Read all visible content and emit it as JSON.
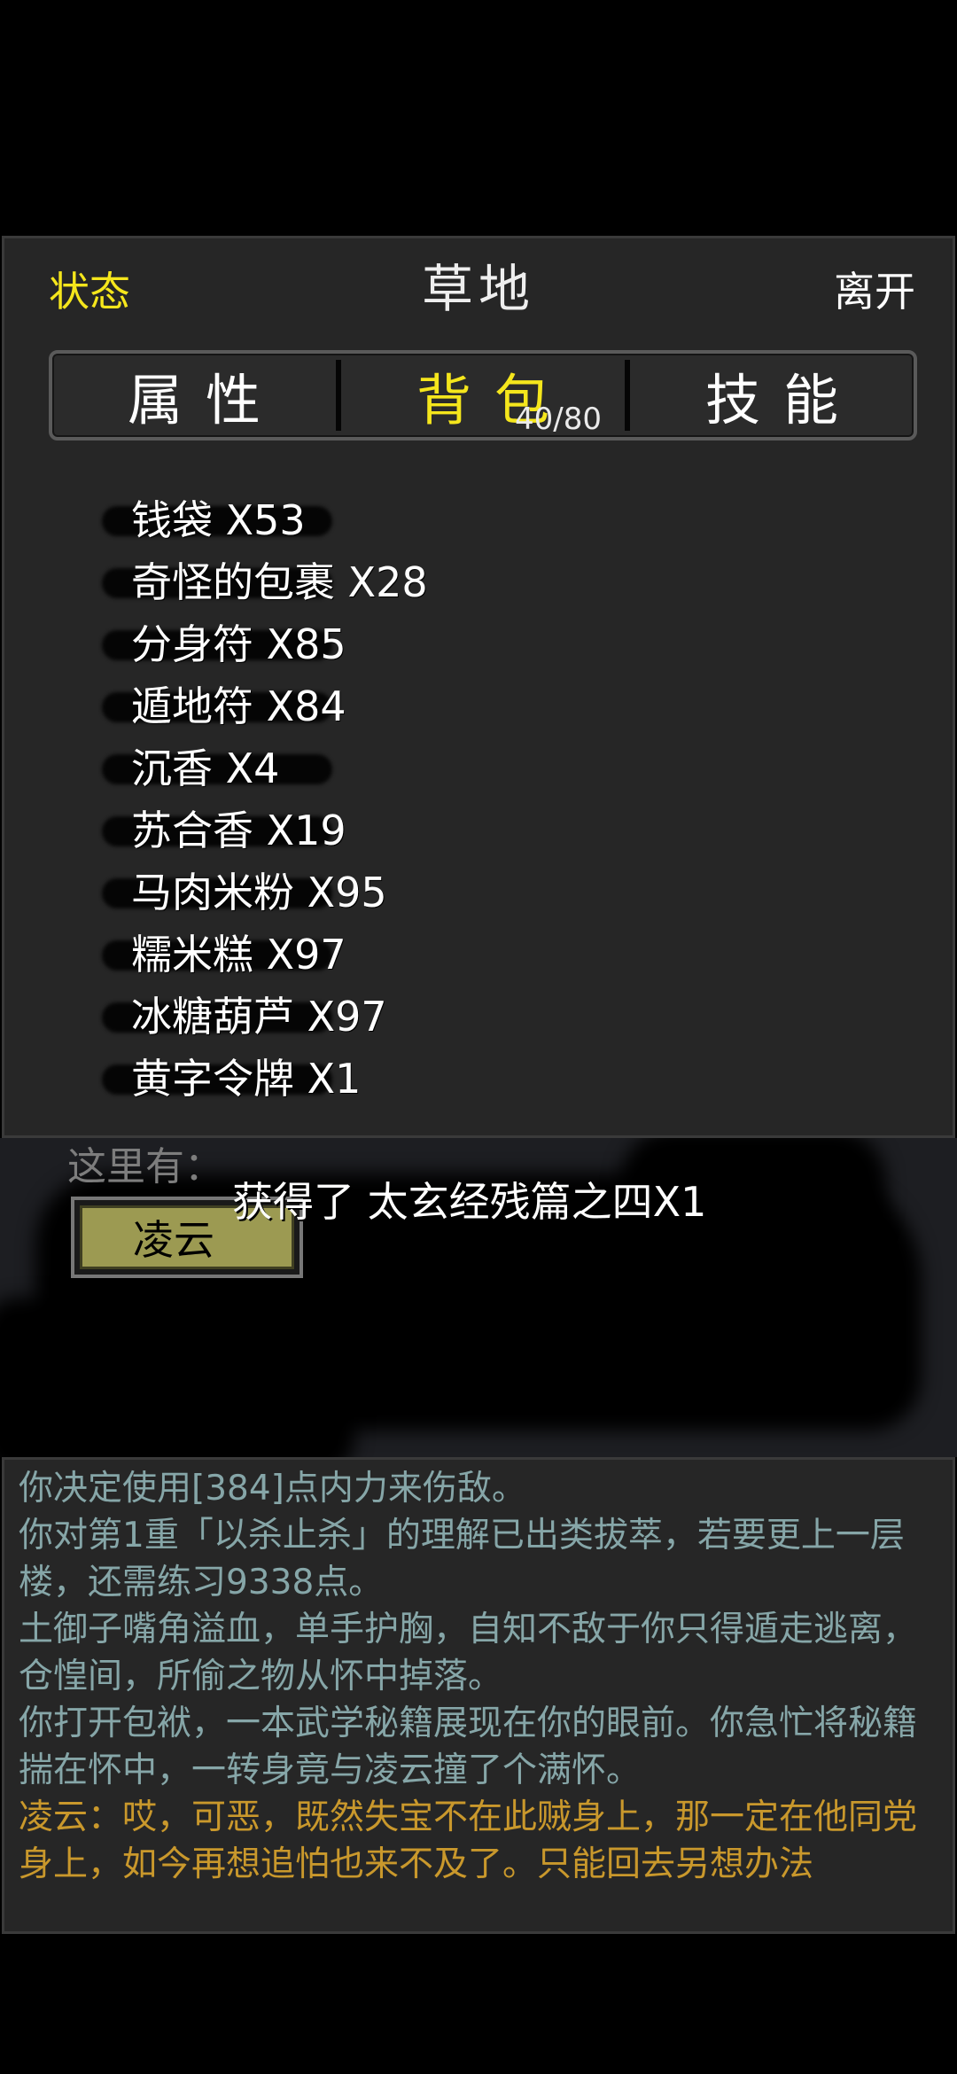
{
  "header": {
    "status_label": "状态",
    "location_title": "草地",
    "leave_label": "离开"
  },
  "tabs": [
    {
      "label": "属性",
      "active": false
    },
    {
      "label": "背包",
      "active": true,
      "count": "40/80"
    },
    {
      "label": "技能",
      "active": false
    }
  ],
  "inventory": {
    "items": [
      "钱袋 X53",
      "奇怪的包裹 X28",
      "分身符 X85",
      "遁地符 X84",
      "沉香 X4",
      "苏合香 X19",
      "马肉米粉 X95",
      "糯米糕 X97",
      "冰糖葫芦 X97",
      "黄字令牌 X1"
    ]
  },
  "scene": {
    "here_label": "这里有：",
    "npc_name": "凌云",
    "toast": "获得了 太玄经残篇之四X1"
  },
  "log": {
    "lines": [
      {
        "text": "你决定使用[384]点内力来伤敌。",
        "style": "normal"
      },
      {
        "text": "你对第1重「以杀止杀」的理解已出类拔萃，若要更上一层楼，还需练习9338点。",
        "style": "normal"
      },
      {
        "text": "土御子嘴角溢血，单手护胸，自知不敌于你只得遁走逃离，仓惶间，所偷之物从怀中掉落。",
        "style": "normal"
      },
      {
        "text": "你打开包袱，一本武学秘籍展现在你的眼前。你急忙将秘籍揣在怀中，一转身竟与凌云撞了个满怀。",
        "style": "normal"
      },
      {
        "text": "凌云：哎，可恶，既然失宝不在此贼身上，那一定在他同党身上，如今再想追怕也来不及了。只能回去另想办法",
        "style": "highlight"
      }
    ]
  },
  "colors": {
    "accent_yellow": "#f5e61c",
    "log_text": "#86a6a8",
    "log_highlight": "#c9982c",
    "panel_bg": "#262626"
  }
}
